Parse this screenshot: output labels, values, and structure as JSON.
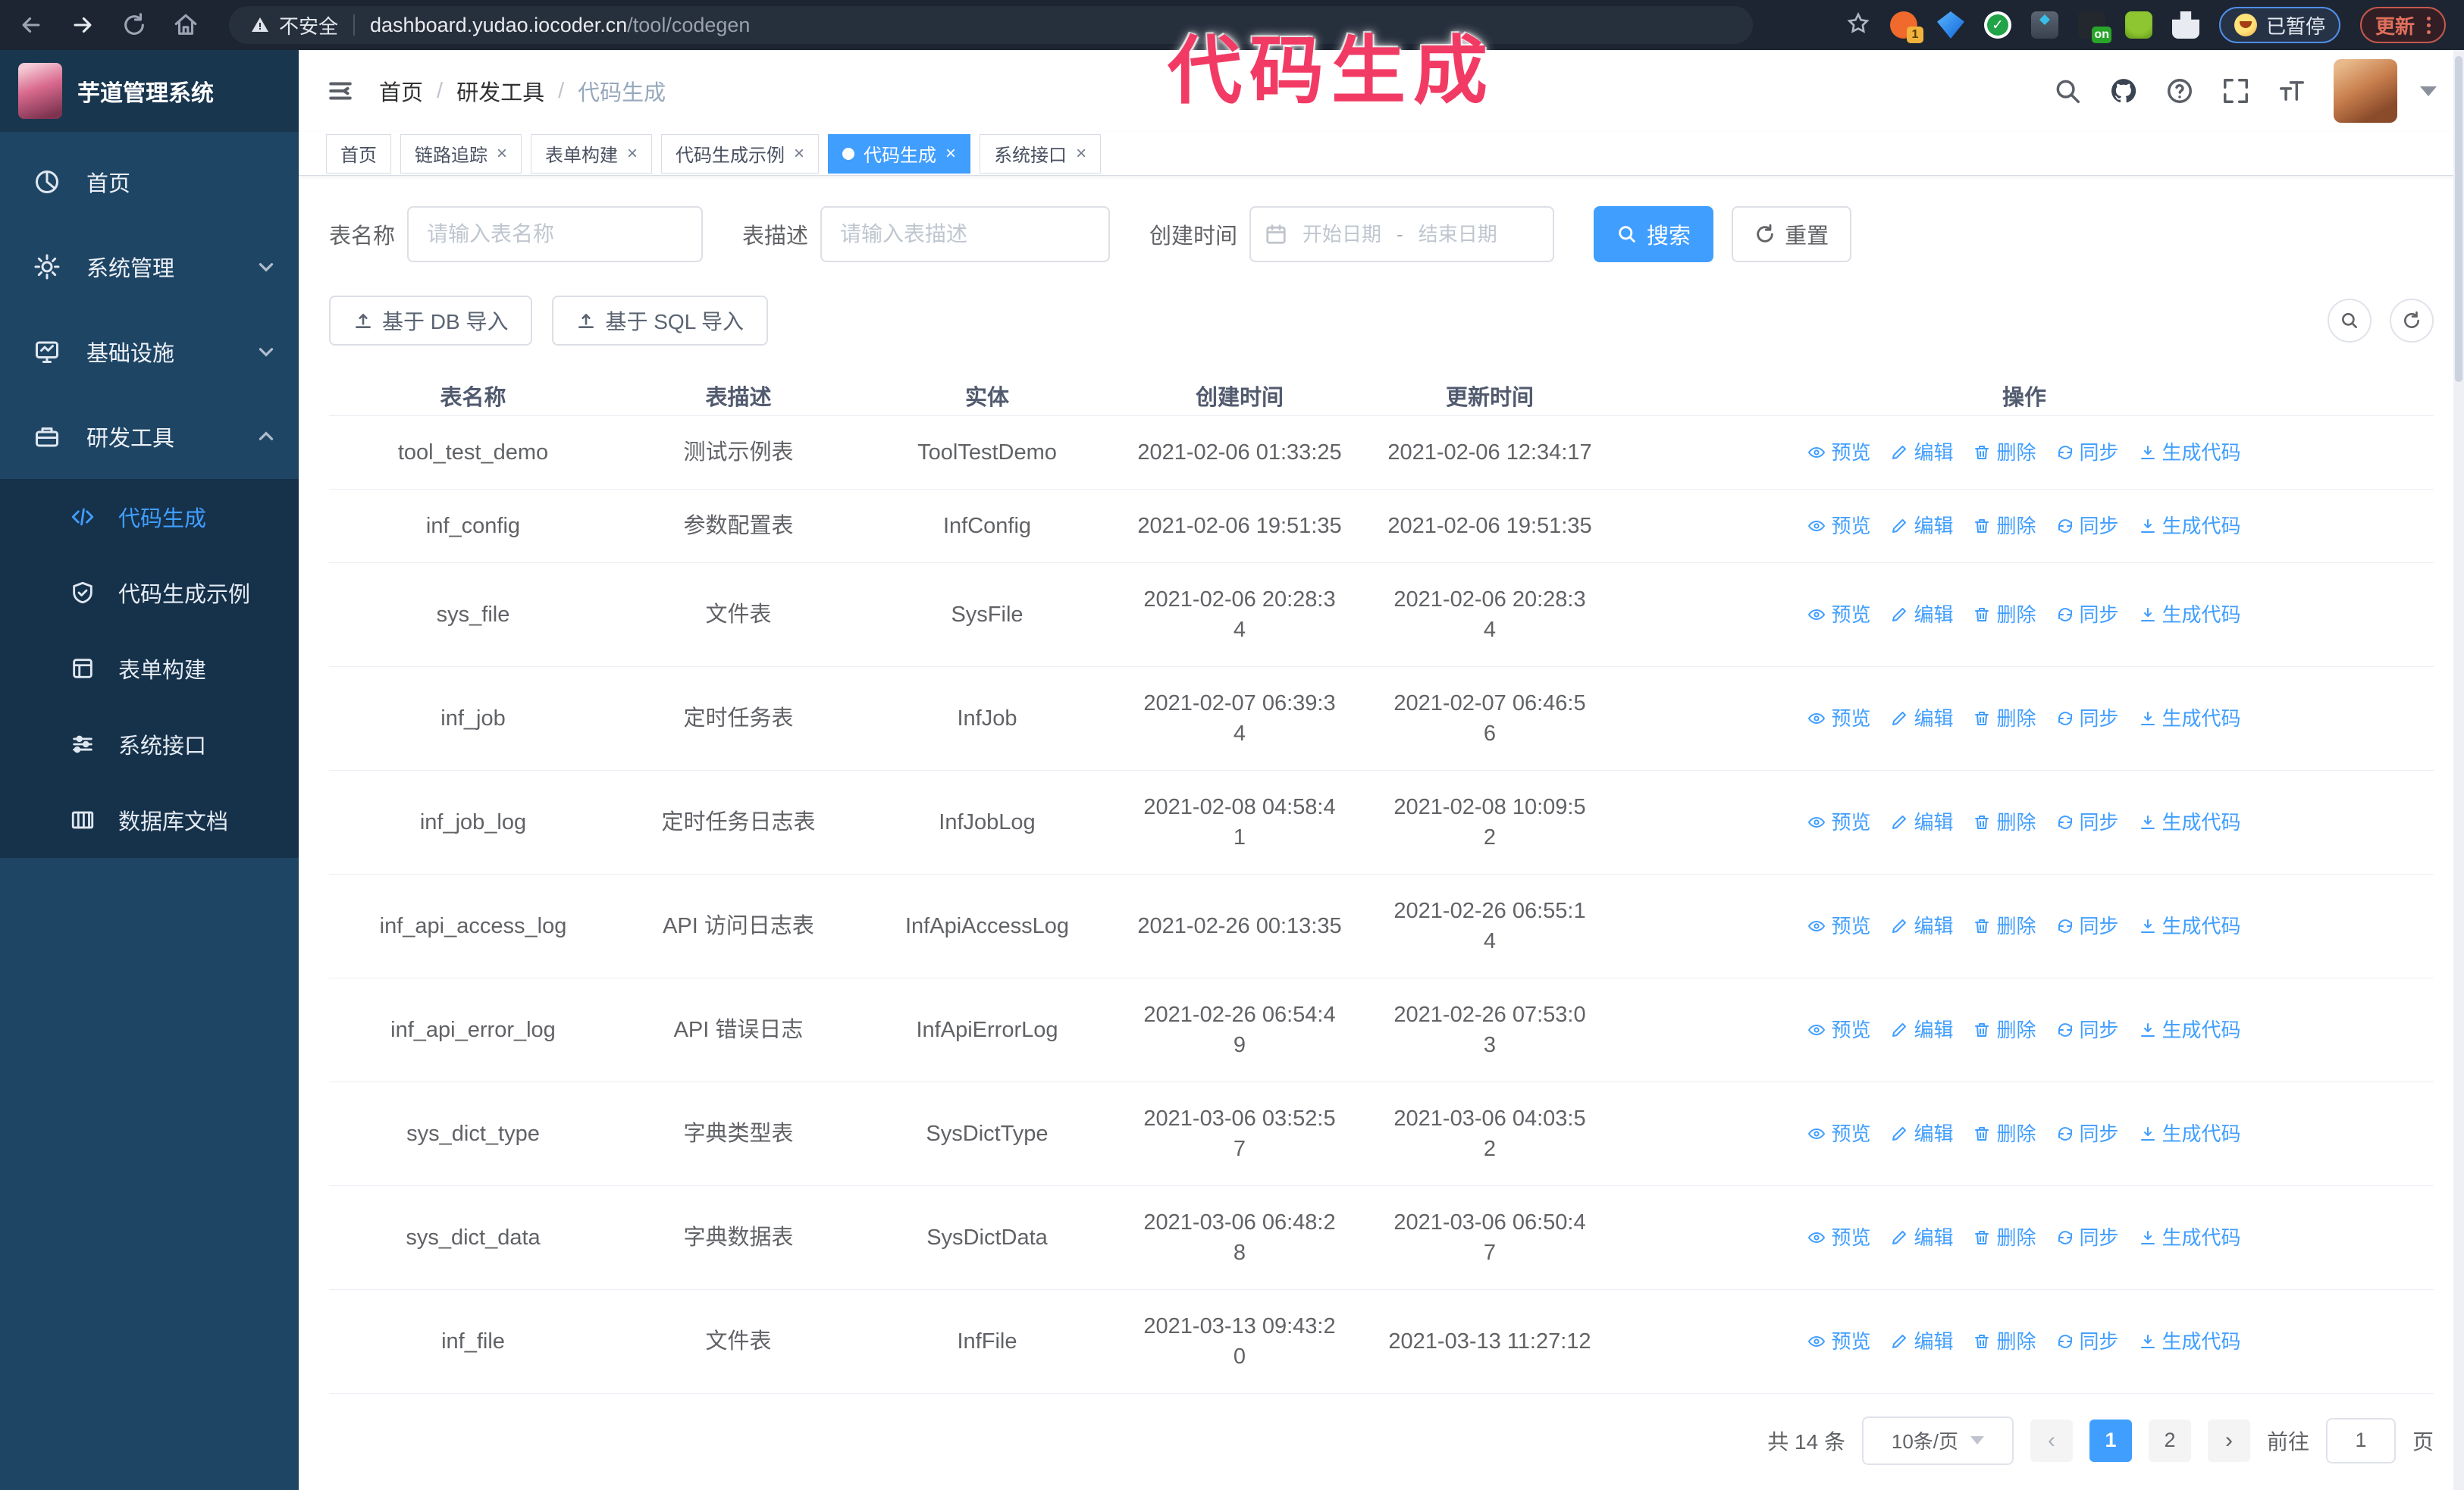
{
  "browser": {
    "security_label": "不安全",
    "url_host": "dashboard.yudao.iocoder.cn",
    "url_path": "/tool/codegen",
    "extension_badge_1": "1",
    "extension_badge_on": "on",
    "profile_badge": "已暂停",
    "update_button": "更新"
  },
  "annotation": {
    "text": "代码生成",
    "color": "#f23b64"
  },
  "sidebar": {
    "app_title": "芋道管理系统",
    "items": [
      {
        "label": "首页"
      },
      {
        "label": "系统管理"
      },
      {
        "label": "基础设施"
      },
      {
        "label": "研发工具"
      }
    ],
    "sub_items": [
      {
        "label": "代码生成",
        "active": true
      },
      {
        "label": "代码生成示例"
      },
      {
        "label": "表单构建"
      },
      {
        "label": "系统接口"
      },
      {
        "label": "数据库文档"
      }
    ]
  },
  "header": {
    "breadcrumb": [
      "首页",
      "研发工具",
      "代码生成"
    ]
  },
  "tags": [
    {
      "label": "首页"
    },
    {
      "label": "链路追踪"
    },
    {
      "label": "表单构建"
    },
    {
      "label": "代码生成示例"
    },
    {
      "label": "代码生成"
    },
    {
      "label": "系统接口"
    }
  ],
  "search": {
    "name_label": "表名称",
    "name_placeholder": "请输入表名称",
    "desc_label": "表描述",
    "desc_placeholder": "请输入表描述",
    "time_label": "创建时间",
    "start_placeholder": "开始日期",
    "separator": "-",
    "end_placeholder": "结束日期",
    "search_label": "搜索",
    "reset_label": "重置"
  },
  "toolbar": {
    "db_import": "基于 DB 导入",
    "sql_import": "基于 SQL 导入"
  },
  "table": {
    "columns": [
      "表名称",
      "表描述",
      "实体",
      "创建时间",
      "更新时间",
      "操作"
    ],
    "actions": [
      "预览",
      "编辑",
      "删除",
      "同步",
      "生成代码"
    ],
    "rows": [
      {
        "name": "tool_test_demo",
        "desc": "测试示例表",
        "entity": "ToolTestDemo",
        "created": "2021-02-06 01:33:25",
        "updated": "2021-02-06 12:34:17"
      },
      {
        "name": "inf_config",
        "desc": "参数配置表",
        "entity": "InfConfig",
        "created": "2021-02-06 19:51:35",
        "updated": "2021-02-06 19:51:35"
      },
      {
        "name": "sys_file",
        "desc": "文件表",
        "entity": "SysFile",
        "created": "2021-02-06 20:28:3\n4",
        "updated": "2021-02-06 20:28:3\n4"
      },
      {
        "name": "inf_job",
        "desc": "定时任务表",
        "entity": "InfJob",
        "created": "2021-02-07 06:39:3\n4",
        "updated": "2021-02-07 06:46:5\n6"
      },
      {
        "name": "inf_job_log",
        "desc": "定时任务日志表",
        "entity": "InfJobLog",
        "created": "2021-02-08 04:58:4\n1",
        "updated": "2021-02-08 10:09:5\n2"
      },
      {
        "name": "inf_api_access_log",
        "desc": "API 访问日志表",
        "entity": "InfApiAccessLog",
        "created": "2021-02-26 00:13:35",
        "updated": "2021-02-26 06:55:1\n4"
      },
      {
        "name": "inf_api_error_log",
        "desc": "API 错误日志",
        "entity": "InfApiErrorLog",
        "created": "2021-02-26 06:54:4\n9",
        "updated": "2021-02-26 07:53:0\n3"
      },
      {
        "name": "sys_dict_type",
        "desc": "字典类型表",
        "entity": "SysDictType",
        "created": "2021-03-06 03:52:5\n7",
        "updated": "2021-03-06 04:03:5\n2"
      },
      {
        "name": "sys_dict_data",
        "desc": "字典数据表",
        "entity": "SysDictData",
        "created": "2021-03-06 06:48:2\n8",
        "updated": "2021-03-06 06:50:4\n7"
      },
      {
        "name": "inf_file",
        "desc": "文件表",
        "entity": "InfFile",
        "created": "2021-03-13 09:43:2\n0",
        "updated": "2021-03-13 11:27:12"
      }
    ]
  },
  "pagination": {
    "total": "共 14 条",
    "page_size": "10条/页",
    "pages": [
      "1",
      "2"
    ],
    "active_page": "1",
    "goto_label": "前往",
    "goto_value": "1",
    "page_unit": "页"
  }
}
